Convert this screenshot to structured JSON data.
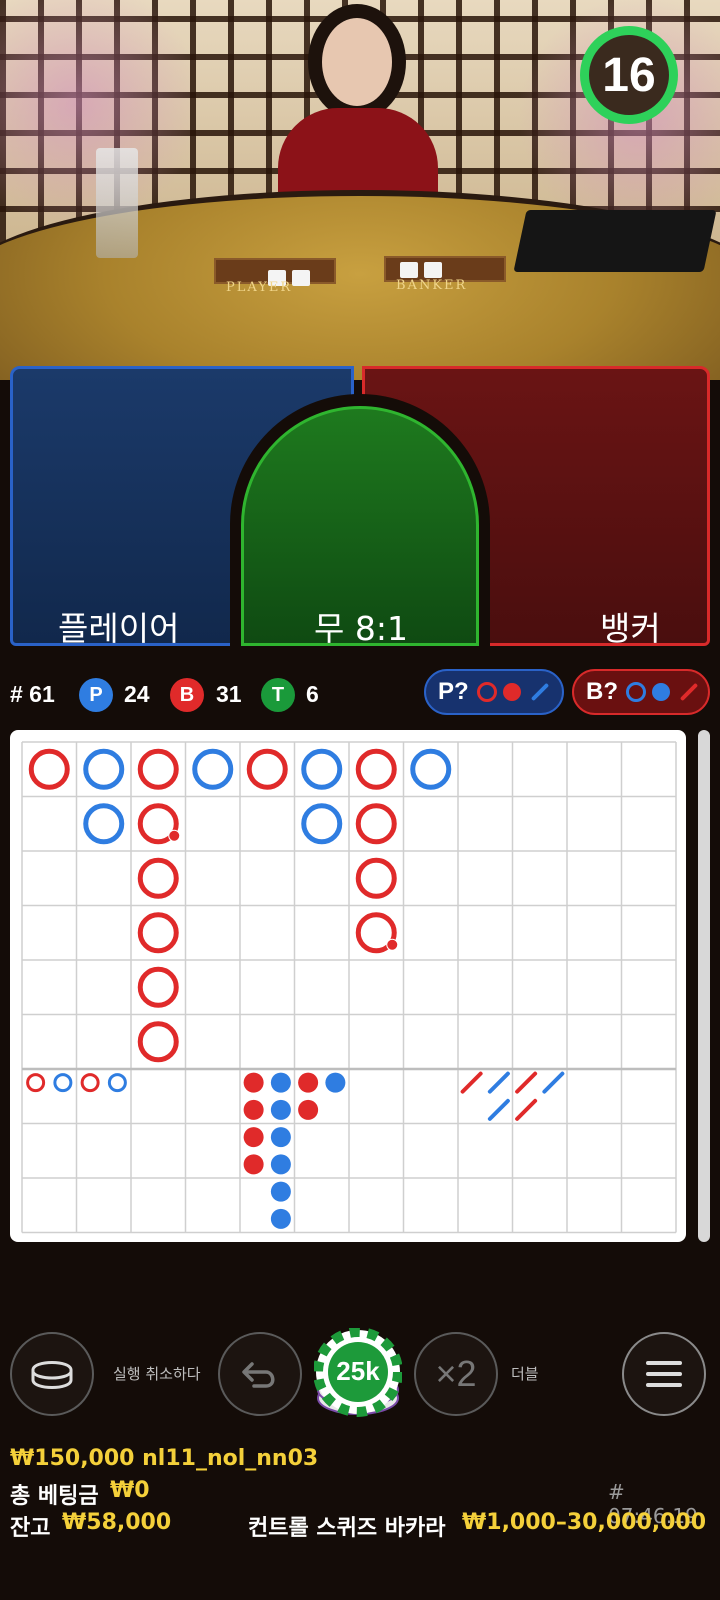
{
  "timer": {
    "value": "16",
    "color": "#2ed15a"
  },
  "table": {
    "player_label": "PLAYER",
    "banker_label": "BANKER"
  },
  "bets": {
    "player": {
      "label": "플레이어",
      "color": "#2a62c8"
    },
    "tie": {
      "label": "무 8:1",
      "color": "#2fb52f"
    },
    "banker": {
      "label": "뱅커",
      "color": "#d82a2a"
    }
  },
  "stats": {
    "round": "# 61",
    "player": {
      "badge": "P",
      "count": "24",
      "color": "#2f7de1"
    },
    "banker": {
      "badge": "B",
      "count": "31",
      "color": "#e02a2a"
    },
    "tie": {
      "badge": "T",
      "count": "6",
      "color": "#1a9a3a"
    },
    "player_predict": {
      "label": "P?"
    },
    "banker_predict": {
      "label": "B?"
    }
  },
  "roadmap": {
    "big_road": [
      [
        {
          "c": "B"
        }
      ],
      [
        {
          "c": "P"
        },
        {
          "c": "P"
        }
      ],
      [
        {
          "c": "B"
        },
        {
          "c": "B",
          "tie": true
        },
        {
          "c": "B"
        },
        {
          "c": "B"
        },
        {
          "c": "B"
        },
        {
          "c": "B"
        }
      ],
      [
        {
          "c": "P"
        }
      ],
      [
        {
          "c": "B"
        }
      ],
      [
        {
          "c": "P"
        },
        {
          "c": "P"
        }
      ],
      [
        {
          "c": "B"
        },
        {
          "c": "B"
        },
        {
          "c": "B"
        },
        {
          "c": "B",
          "tie": true
        }
      ],
      [
        {
          "c": "P"
        }
      ]
    ],
    "big_eye": [
      [
        "B"
      ],
      [
        "P"
      ],
      [
        "B"
      ],
      [
        "P"
      ]
    ],
    "small_road": [
      [
        "B",
        "B",
        "B",
        "B"
      ],
      [
        "P",
        "P",
        "P",
        "P",
        "P",
        "P"
      ],
      [
        "B",
        "B"
      ],
      [
        "P"
      ]
    ],
    "cockroach": [
      [
        "B"
      ],
      [
        "P",
        "P"
      ],
      [
        "B",
        "B"
      ],
      [
        "P"
      ]
    ],
    "colors": {
      "banker": "#e02a2a",
      "player": "#2f7de1"
    }
  },
  "controls": {
    "undo_label": "실행 취소하다",
    "chip_value": "25k",
    "double_label": "더블",
    "double_symbol": "×2"
  },
  "footer": {
    "balance_line": "₩150,000 nl11_nol_nn03",
    "total_bet_label": "총 베팅금",
    "total_bet_value": "₩0",
    "round_id": "# 07:46:19",
    "balance_label": "잔고",
    "balance_value": "₩58,000",
    "game_name": "컨트롤 스퀴즈 바카라",
    "limits": "₩1,000–30,000,000"
  }
}
